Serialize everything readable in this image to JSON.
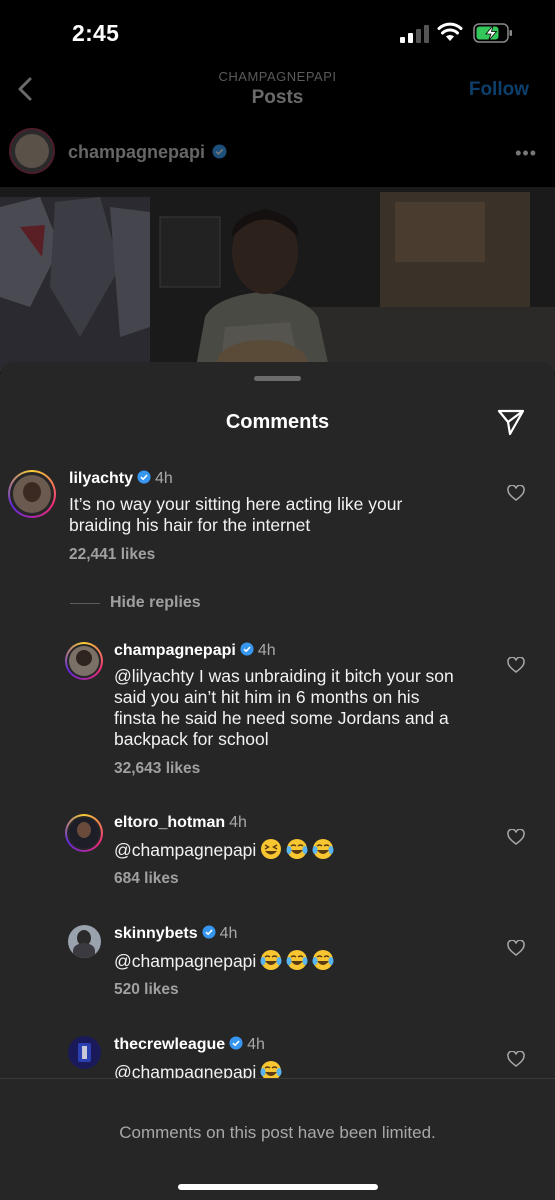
{
  "status_bar": {
    "time": "2:45"
  },
  "header": {
    "account": "CHAMPAGNEPAPI",
    "title": "Posts",
    "follow_label": "Follow"
  },
  "post": {
    "author": "champagnepapi",
    "more_label": "•••"
  },
  "sheet": {
    "title": "Comments",
    "hide_replies_label": "Hide replies",
    "limited_notice": "Comments on this post have been limited."
  },
  "comments": [
    {
      "username": "lilyachty",
      "time": "4h",
      "text_lines": [
        "It’s no way your sitting here acting like your",
        "braiding his hair for the internet"
      ],
      "likes": "22,441 likes"
    },
    {
      "username": "champagnepapi",
      "time": "4h",
      "mention": "@lilyachty",
      "text_lines": [
        "@lilyachty I was unbraiding it bitch your son",
        "said you ain’t hit him in 6 months on his",
        "finsta he said he need some Jordans and a",
        "backpack for school"
      ],
      "likes": "32,643 likes"
    },
    {
      "username": "eltoro_hotman",
      "time": "4h",
      "text": "@champagnepapi",
      "likes": "684 likes"
    },
    {
      "username": "skinnybets",
      "time": "4h",
      "text": "@champagnepapi",
      "likes": "520 likes"
    },
    {
      "username": "thecrewleague",
      "time": "4h",
      "text": "@champagnepapi"
    }
  ],
  "colors": {
    "accent_blue": "#3797f0",
    "sheet_bg": "#262626",
    "muted_text": "#a8a8a8",
    "emoji_yellow": "#f7c631"
  }
}
